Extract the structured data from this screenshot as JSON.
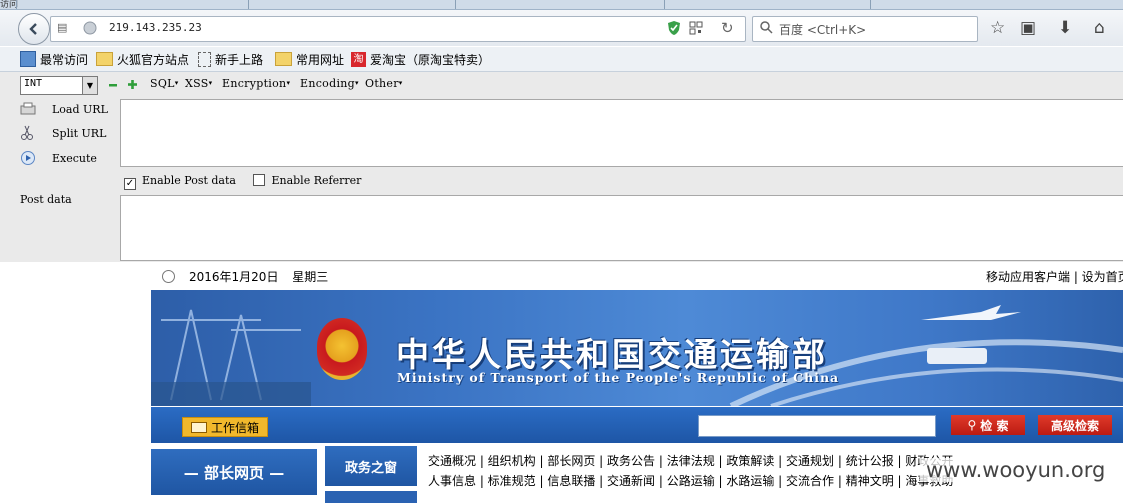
{
  "tabstrip": {
    "tab_text": "访问"
  },
  "navbar": {
    "url": "219.143.235.23",
    "search_placeholder": "百度 <Ctrl+K>"
  },
  "bookmarks": [
    {
      "label": "最常访问",
      "icon": "search-icon"
    },
    {
      "label": "火狐官方站点",
      "icon": "folder-icon"
    },
    {
      "label": "新手上路",
      "icon": "dashed-page-icon"
    },
    {
      "label": "常用网址",
      "icon": "folder-icon"
    },
    {
      "label": "爱淘宝（原淘宝特卖）",
      "icon": "taobao-icon"
    }
  ],
  "hackbar": {
    "select_value": "INT",
    "menus": [
      "SQL",
      "XSS",
      "Encryption",
      "Encoding",
      "Other"
    ],
    "buttons": [
      "Load URL",
      "Split URL",
      "Execute"
    ],
    "enable_post": "Enable Post data",
    "enable_referrer": "Enable Referrer",
    "post_label": "Post data",
    "enable_post_checked": true,
    "enable_referrer_checked": false
  },
  "page": {
    "date": "2016年1月20日",
    "weekday": "星期三",
    "toplinks": "移动应用客户端 | 设为首页",
    "title_cn": "中华人民共和国交通运输部",
    "title_en": "Ministry of Transport of the People's Republic of China",
    "mail_label": "工作信箱",
    "search_btn": "检 索",
    "adv_search_btn": "高级检索",
    "left_nav": "— 部长网页 —",
    "zw_tab": "政务之窗",
    "links_row1": "交通概况 | 组织机构 | 部长网页 | 政务公告 | 法律法规 | 政策解读 | 交通规划 | 统计公报 | 财政公开",
    "links_row2": "人事信息 | 标准规范 | 信息联播 | 交通新闻 | 公路运输 | 水路运输 | 交流合作 | 精神文明 | 海事救助"
  },
  "watermark": "www.wooyun.org",
  "colors": {
    "accent": "#1f56a3",
    "search_red": "#c8231a",
    "mail_yellow": "#f1b82c"
  }
}
